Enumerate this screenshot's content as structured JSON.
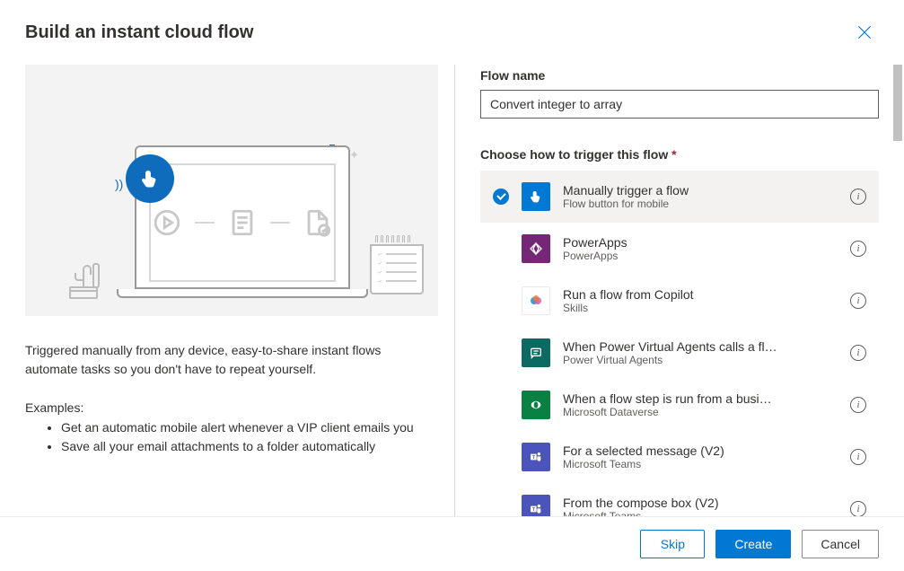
{
  "dialog": {
    "title": "Build an instant cloud flow",
    "description": "Triggered manually from any device, easy-to-share instant flows automate tasks so you don't have to repeat yourself.",
    "examples_label": "Examples:",
    "examples": [
      "Get an automatic mobile alert whenever a VIP client emails you",
      "Save all your email attachments to a folder automatically"
    ]
  },
  "form": {
    "flow_name_label": "Flow name",
    "flow_name_value": "Convert integer to array",
    "trigger_label": "Choose how to trigger this flow",
    "required_star": "*"
  },
  "triggers": [
    {
      "name": "Manually trigger a flow",
      "source": "Flow button for mobile",
      "selected": true,
      "icon_class": "icon-blue",
      "icon_key": "touch"
    },
    {
      "name": "PowerApps",
      "source": "PowerApps",
      "selected": false,
      "icon_class": "icon-purple",
      "icon_key": "diamond"
    },
    {
      "name": "Run a flow from Copilot",
      "source": "Skills",
      "selected": false,
      "icon_class": "icon-white",
      "icon_key": "copilot"
    },
    {
      "name": "When Power Virtual Agents calls a fl…",
      "source": "Power Virtual Agents",
      "selected": false,
      "icon_class": "icon-teal",
      "icon_key": "chat"
    },
    {
      "name": "When a flow step is run from a busi…",
      "source": "Microsoft Dataverse",
      "selected": false,
      "icon_class": "icon-green",
      "icon_key": "dataverse"
    },
    {
      "name": "For a selected message (V2)",
      "source": "Microsoft Teams",
      "selected": false,
      "icon_class": "icon-msteams",
      "icon_key": "teams"
    },
    {
      "name": "From the compose box (V2)",
      "source": "Microsoft Teams",
      "selected": false,
      "icon_class": "icon-msteams",
      "icon_key": "teams"
    }
  ],
  "footer": {
    "skip_label": "Skip",
    "create_label": "Create",
    "cancel_label": "Cancel"
  },
  "info_char": "i"
}
